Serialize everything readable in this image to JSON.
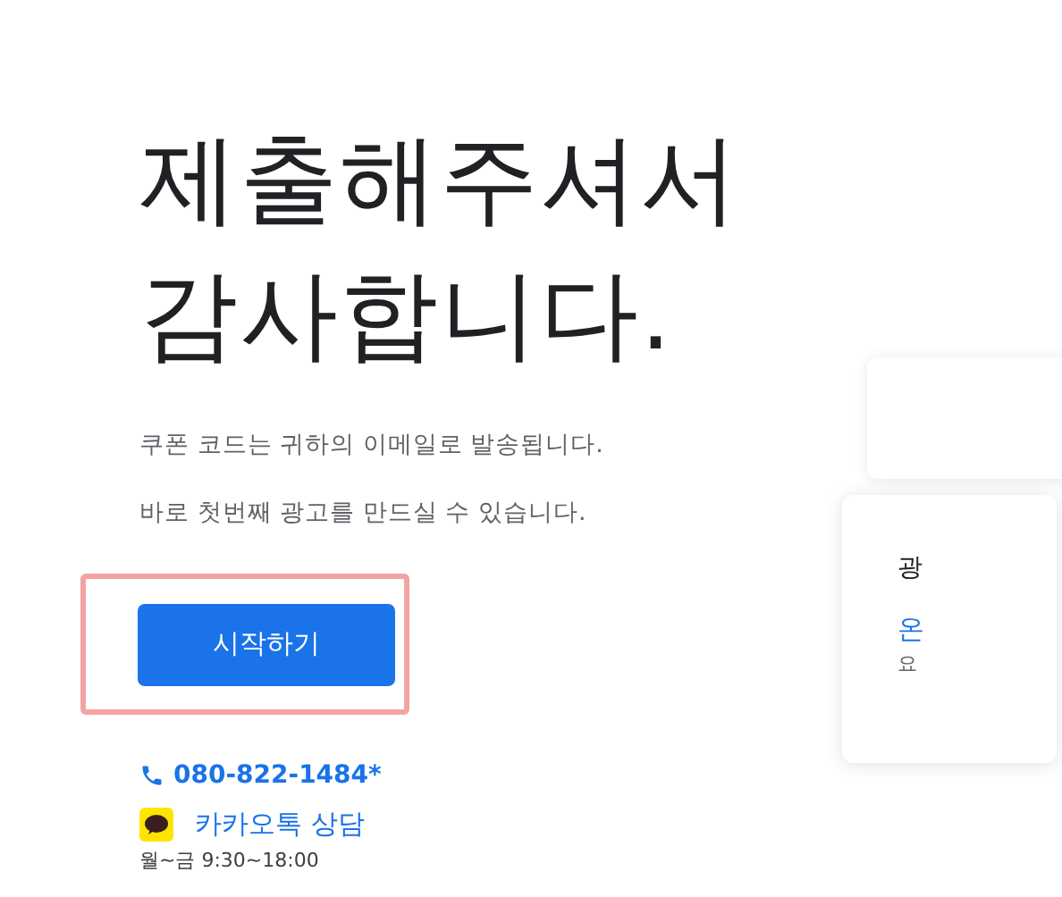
{
  "headline": [
    "제출해주셔서",
    "감사합니다."
  ],
  "messages": [
    "쿠폰 코드는 귀하의 이메일로 발송됩니다.",
    "바로 첫번째 광고를 만드실 수 있습니다."
  ],
  "start_button": {
    "label": "시작하기"
  },
  "phone": {
    "label": "080-822-1484*"
  },
  "kakao": {
    "label": "카카오톡 상담",
    "hours": "월~금 9:30~18:00"
  },
  "side_card": {
    "title": "광",
    "link": "온",
    "note": "요"
  }
}
